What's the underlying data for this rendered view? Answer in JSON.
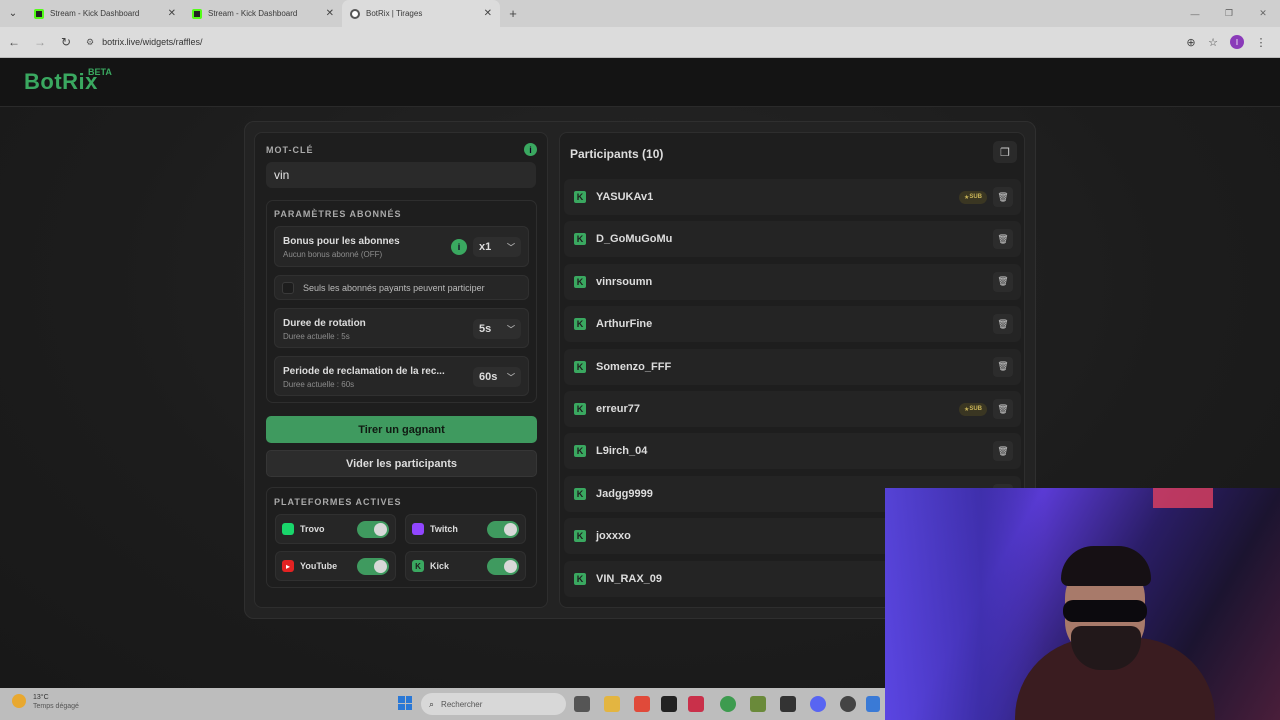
{
  "browser": {
    "tabs": [
      {
        "title": "Stream - Kick Dashboard",
        "active": false
      },
      {
        "title": "Stream - Kick Dashboard",
        "active": false
      },
      {
        "title": "BotRix | Tirages",
        "active": true
      }
    ],
    "url": "botrix.live/widgets/raffles/",
    "profile_initial": "I"
  },
  "site": {
    "logo": "BotRix",
    "badge": "BETA"
  },
  "keyword": {
    "label": "MOT-CLÉ",
    "value": "vin"
  },
  "subscriber_settings": {
    "title": "PARAMÈTRES ABONNÉS",
    "bonus": {
      "label": "Bonus pour les abonnes",
      "desc": "Aucun bonus abonné (OFF)",
      "value": "x1"
    },
    "only_paid": {
      "label": "Seuls les abonnés payants peuvent participer",
      "checked": false
    },
    "rotation": {
      "label": "Duree de rotation",
      "desc": "Duree actuelle : 5s",
      "value": "5s"
    },
    "claim": {
      "label": "Periode de reclamation de la rec...",
      "desc": "Duree actuelle : 60s",
      "value": "60s"
    }
  },
  "actions": {
    "draw": "Tirer un gagnant",
    "clear": "Vider les participants"
  },
  "platforms": {
    "title": "PLATEFORMES ACTIVES",
    "items": [
      {
        "name": "Trovo",
        "enabled": true,
        "color": "#19d66b"
      },
      {
        "name": "Twitch",
        "enabled": true,
        "color": "#9146ff"
      },
      {
        "name": "YouTube",
        "enabled": true,
        "color": "#ff0000"
      },
      {
        "name": "Kick",
        "enabled": true,
        "color": "#53fc18"
      }
    ]
  },
  "participants": {
    "title": "Participants (10)",
    "sub_label": "SUB",
    "list": [
      {
        "name": "YASUKAv1",
        "sub": true
      },
      {
        "name": "D_GoMuGoMu",
        "sub": false
      },
      {
        "name": "vinrsoumn",
        "sub": false
      },
      {
        "name": "ArthurFine",
        "sub": false
      },
      {
        "name": "Somenzo_FFF",
        "sub": false
      },
      {
        "name": "erreur77",
        "sub": true
      },
      {
        "name": "L9irch_04",
        "sub": false
      },
      {
        "name": "Jadgg9999",
        "sub": false
      },
      {
        "name": "joxxxo",
        "sub": false
      },
      {
        "name": "VIN_RAX_09",
        "sub": false
      }
    ]
  },
  "taskbar": {
    "temperature": "13°C",
    "weather": "Temps dégagé",
    "search_placeholder": "Rechercher"
  },
  "colors": {
    "accent": "#3aa860",
    "panel": "#1e1e1e"
  }
}
